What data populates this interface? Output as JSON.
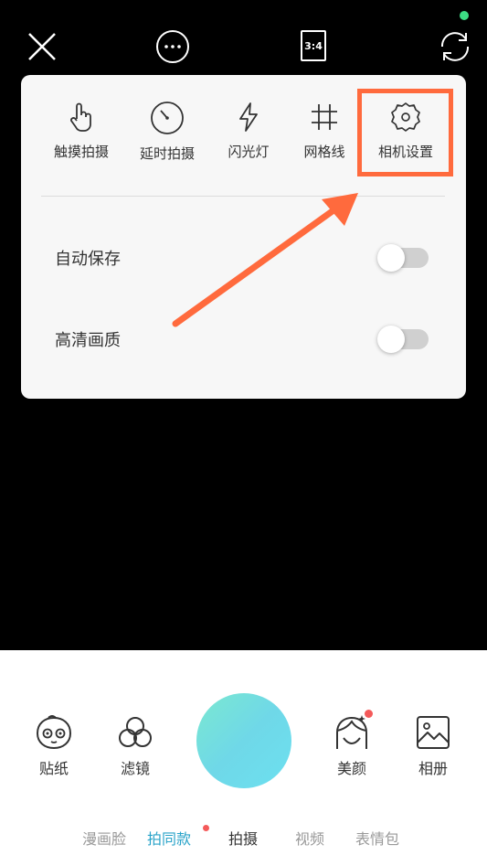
{
  "top_bar": {
    "ratio_label": "3:4"
  },
  "panel": {
    "tools": [
      {
        "label": "触摸拍摄",
        "icon": "touch-icon"
      },
      {
        "label": "延时拍摄",
        "icon": "timer-icon"
      },
      {
        "label": "闪光灯",
        "icon": "flash-icon"
      },
      {
        "label": "网格线",
        "icon": "grid-icon"
      },
      {
        "label": "相机设置",
        "icon": "gear-icon"
      }
    ],
    "rows": [
      {
        "label": "自动保存",
        "enabled": false
      },
      {
        "label": "高清画质",
        "enabled": false
      }
    ]
  },
  "bottom": {
    "tools": [
      {
        "label": "贴纸",
        "icon": "sticker-icon"
      },
      {
        "label": "滤镜",
        "icon": "filter-icon"
      },
      {
        "label": "美颜",
        "icon": "beauty-icon"
      },
      {
        "label": "相册",
        "icon": "album-icon"
      }
    ],
    "modes": [
      "漫画脸",
      "拍同款",
      "拍摄",
      "视频",
      "表情包"
    ]
  },
  "colors": {
    "accent": "#29a3c9",
    "highlight": "#ff6a3d",
    "notification": "#f45a5a",
    "status": "#3ddc84"
  }
}
